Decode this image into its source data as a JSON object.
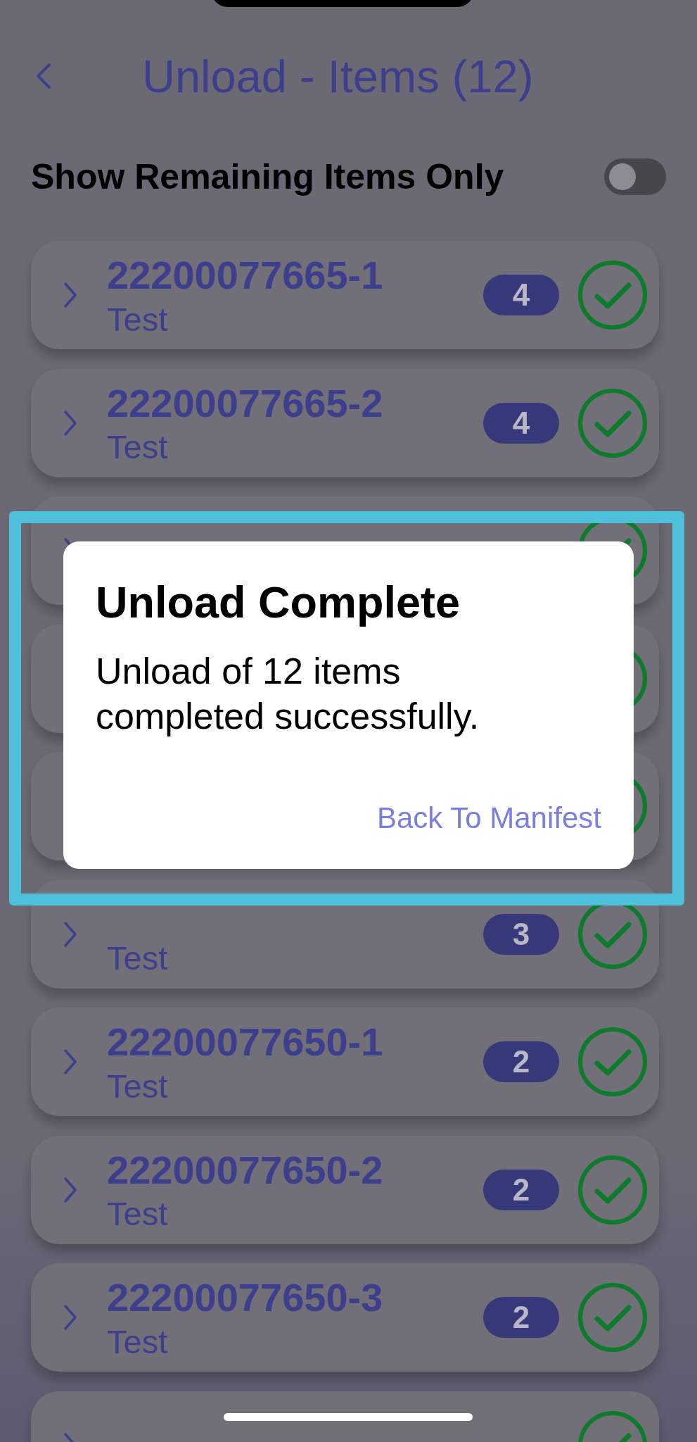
{
  "header": {
    "title": "Unload - Items (12)"
  },
  "filter": {
    "label": "Show Remaining Items Only",
    "on": false
  },
  "items": [
    {
      "number": "22200077665-1",
      "subtitle": "Test",
      "count": "4",
      "done": true
    },
    {
      "number": "22200077665-2",
      "subtitle": "Test",
      "count": "4",
      "done": true
    },
    {
      "done": true
    },
    {
      "done": true
    },
    {
      "done": true
    },
    {
      "subtitle": "Test",
      "count": "3",
      "done": true
    },
    {
      "number": "22200077650-1",
      "subtitle": "Test",
      "count": "2",
      "done": true
    },
    {
      "number": "22200077650-2",
      "subtitle": "Test",
      "count": "2",
      "done": true
    },
    {
      "number": "22200077650-3",
      "subtitle": "Test",
      "count": "2",
      "done": true
    },
    {
      "done": true
    }
  ],
  "dialog": {
    "title": "Unload Complete",
    "message": "Unload of 12 items completed successfully.",
    "button": "Back To Manifest"
  }
}
